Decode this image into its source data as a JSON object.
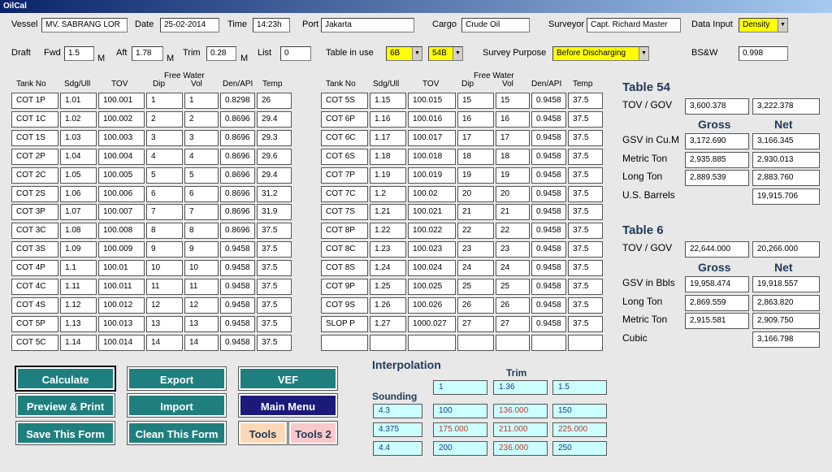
{
  "window_title": "OilCal",
  "header": {
    "vessel_label": "Vessel",
    "vessel": "MV. SABRANG LOR",
    "date_label": "Date",
    "date": "25-02-2014",
    "time_label": "Time",
    "time": "14:23h",
    "port_label": "Port",
    "port": "Jakarta",
    "cargo_label": "Cargo",
    "cargo": "Crude Oil",
    "surveyor_label": "Surveyor",
    "surveyor": "Capt. Richard Master",
    "data_input_label": "Data Input",
    "data_input": "Density"
  },
  "draft": {
    "draft_label": "Draft",
    "fwd_label": "Fwd",
    "fwd": "1.5",
    "m": "M",
    "aft_label": "Aft",
    "aft": "1.78",
    "trim_label": "Trim",
    "trim": "0.28",
    "list_label": "List",
    "list": "0",
    "table_label": "Table in use",
    "table_a": "6B",
    "table_b": "54B",
    "purpose_label": "Survey Purpose",
    "purpose": "Before Discharging",
    "bsw_label": "BS&W",
    "bsw": "0.998"
  },
  "cols": {
    "tank": "Tank No",
    "sdg": "Sdg/Ull",
    "tov": "TOV",
    "fw": "Free Water",
    "dip": "Dip",
    "vol": "Vol",
    "den": "Den/API",
    "temp": "Temp"
  },
  "left_rows": [
    [
      "COT 1P",
      "1.01",
      "100.001",
      "1",
      "1",
      "0.8298",
      "26"
    ],
    [
      "COT 1C",
      "1.02",
      "100.002",
      "2",
      "2",
      "0.8696",
      "29.4"
    ],
    [
      "COT 1S",
      "1.03",
      "100.003",
      "3",
      "3",
      "0.8696",
      "29.3"
    ],
    [
      "COT 2P",
      "1.04",
      "100.004",
      "4",
      "4",
      "0.8696",
      "29.6"
    ],
    [
      "COT 2C",
      "1.05",
      "100.005",
      "5",
      "5",
      "0.8696",
      "29.4"
    ],
    [
      "COT 2S",
      "1.06",
      "100.006",
      "6",
      "6",
      "0.8696",
      "31.2"
    ],
    [
      "COT 3P",
      "1.07",
      "100.007",
      "7",
      "7",
      "0.8696",
      "31.9"
    ],
    [
      "COT 3C",
      "1.08",
      "100.008",
      "8",
      "8",
      "0.8696",
      "37.5"
    ],
    [
      "COT 3S",
      "1.09",
      "100.009",
      "9",
      "9",
      "0.9458",
      "37.5"
    ],
    [
      "COT 4P",
      "1.1",
      "100.01",
      "10",
      "10",
      "0.9458",
      "37.5"
    ],
    [
      "COT 4C",
      "1.11",
      "100.011",
      "11",
      "11",
      "0.9458",
      "37.5"
    ],
    [
      "COT 4S",
      "1.12",
      "100.012",
      "12",
      "12",
      "0.9458",
      "37.5"
    ],
    [
      "COT 5P",
      "1.13",
      "100.013",
      "13",
      "13",
      "0.9458",
      "37.5"
    ],
    [
      "COT 5C",
      "1.14",
      "100.014",
      "14",
      "14",
      "0.9458",
      "37.5"
    ]
  ],
  "right_rows": [
    [
      "COT 5S",
      "1.15",
      "100.015",
      "15",
      "15",
      "0.9458",
      "37.5"
    ],
    [
      "COT 6P",
      "1.16",
      "100.016",
      "16",
      "16",
      "0.9458",
      "37.5"
    ],
    [
      "COT 6C",
      "1.17",
      "100.017",
      "17",
      "17",
      "0.9458",
      "37.5"
    ],
    [
      "COT 6S",
      "1.18",
      "100.018",
      "18",
      "18",
      "0.9458",
      "37.5"
    ],
    [
      "COT 7P",
      "1.19",
      "100.019",
      "19",
      "19",
      "0.9458",
      "37.5"
    ],
    [
      "COT 7C",
      "1.2",
      "100.02",
      "20",
      "20",
      "0.9458",
      "37.5"
    ],
    [
      "COT 7S",
      "1.21",
      "100.021",
      "21",
      "21",
      "0.9458",
      "37.5"
    ],
    [
      "COT 8P",
      "1.22",
      "100.022",
      "22",
      "22",
      "0.9458",
      "37.5"
    ],
    [
      "COT 8C",
      "1.23",
      "100.023",
      "23",
      "23",
      "0.9458",
      "37.5"
    ],
    [
      "COT 8S",
      "1.24",
      "100.024",
      "24",
      "24",
      "0.9458",
      "37.5"
    ],
    [
      "COT 9P",
      "1.25",
      "100.025",
      "25",
      "25",
      "0.9458",
      "37.5"
    ],
    [
      "COT 9S",
      "1.26",
      "100.026",
      "26",
      "26",
      "0.9458",
      "37.5"
    ],
    [
      "SLOP P",
      "1.27",
      "1000.027",
      "27",
      "27",
      "0.9458",
      "37.5"
    ],
    [
      "",
      "",
      "",
      "",
      "",
      "",
      ""
    ]
  ],
  "t54": {
    "title": "Table 54",
    "tov_label": "TOV / GOV",
    "tov_gross": "3,600.378",
    "tov_net": "3,222.378",
    "gross": "Gross",
    "net": "Net",
    "rows": [
      {
        "label": "GSV in Cu.M",
        "g": "3,172.690",
        "n": "3,166.345"
      },
      {
        "label": "Metric Ton",
        "g": "2,935.885",
        "n": "2,930.013"
      },
      {
        "label": "Long Ton",
        "g": "2,889.539",
        "n": "2,883.760"
      },
      {
        "label": "U.S. Barrels",
        "g": "",
        "n": "19,915.706"
      }
    ]
  },
  "t6": {
    "title": "Table 6",
    "tov_label": "TOV / GOV",
    "tov_gross": "22,644.000",
    "tov_net": "20,266.000",
    "gross": "Gross",
    "net": "Net",
    "rows": [
      {
        "label": "GSV in Bbls",
        "g": "19,958.474",
        "n": "19,918.557"
      },
      {
        "label": "Long Ton",
        "g": "2,869.559",
        "n": "2,863.820"
      },
      {
        "label": "Metric Ton",
        "g": "2,915.581",
        "n": "2,909.750"
      },
      {
        "label": "Cubic",
        "g": "",
        "n": "3,166.798"
      }
    ]
  },
  "buttons": {
    "calculate": "Calculate",
    "export": "Export",
    "vef": "VEF",
    "preview": "Preview & Print",
    "import": "Import",
    "main_menu": "Main Menu",
    "save": "Save This Form",
    "clean": "Clean This Form",
    "tools": "Tools",
    "tools2": "Tools 2"
  },
  "interp": {
    "title": "Interpolation",
    "trim": "Trim",
    "sounding": "Sounding",
    "trim_vals": [
      "1",
      "1.36",
      "1.5"
    ],
    "rows": [
      {
        "s": "4.3",
        "v": [
          "100",
          "136.000",
          "150"
        ]
      },
      {
        "s": "4.375",
        "v": [
          "175.000",
          "211.000",
          "225.000"
        ]
      },
      {
        "s": "4.4",
        "v": [
          "200",
          "236.000",
          "250"
        ]
      }
    ]
  }
}
